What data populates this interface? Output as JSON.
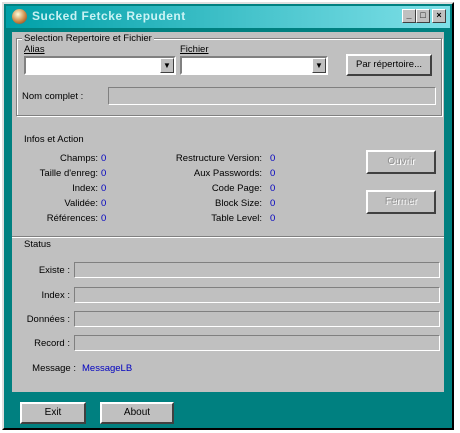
{
  "window": {
    "title": "Sucked Fetcke  Repudent"
  },
  "selection": {
    "group_title": "Selection Repertoire et Fichier",
    "alias_label": "Alias",
    "fichier_label": "Fichier",
    "par_repertoire_label": "Par répertoire...",
    "nom_complet_label": "Nom complet :"
  },
  "infos": {
    "group_title": "Infos et Action",
    "left": [
      {
        "label": "Champs:",
        "value": "0"
      },
      {
        "label": "Taille d'enreg:",
        "value": "0"
      },
      {
        "label": "Index:",
        "value": "0"
      },
      {
        "label": "Validée:",
        "value": "0"
      },
      {
        "label": "Références:",
        "value": "0"
      }
    ],
    "right": [
      {
        "label": "Restructure Version:",
        "value": "0"
      },
      {
        "label": "Aux Passwords:",
        "value": "0"
      },
      {
        "label": "Code Page:",
        "value": "0"
      },
      {
        "label": "Block Size:",
        "value": "0"
      },
      {
        "label": "Table Level:",
        "value": "0"
      }
    ],
    "button1": "Ouvrir",
    "button2": "Fermer"
  },
  "status": {
    "group_title": "Status",
    "existe_label": "Existe :",
    "index_label": "Index :",
    "donnees_label": "Données :",
    "record_label": "Record :",
    "message_label": "Message :",
    "message_value": "MessageLB"
  },
  "footer": {
    "exit": "Exit",
    "about": "About"
  }
}
